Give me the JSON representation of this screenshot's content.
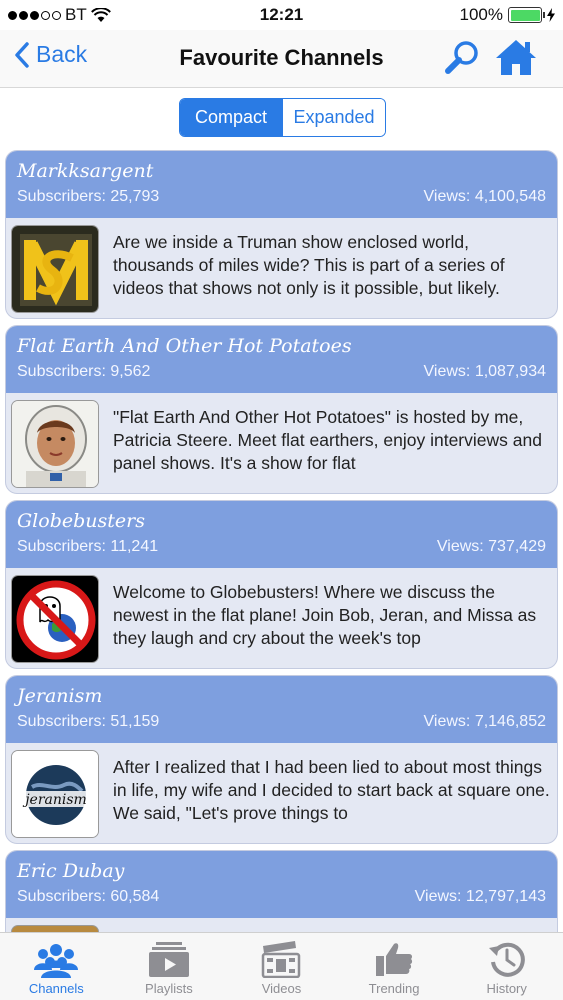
{
  "status": {
    "carrier": "BT",
    "time": "12:21",
    "battery": "100%"
  },
  "nav": {
    "back_label": "Back",
    "title": "Favourite Channels"
  },
  "segments": {
    "compact": "Compact",
    "expanded": "Expanded",
    "selected": "Compact"
  },
  "channels": [
    {
      "name": "Markksargent",
      "subscribers": "Subscribers: 25,793",
      "views": "Views: 4,100,548",
      "description": "Are we inside a Truman show enclosed world, thousands of miles wide? This is part of a series of videos that shows not only is it possible, but likely."
    },
    {
      "name": "Flat Earth And Other Hot Potatoes",
      "subscribers": "Subscribers: 9,562",
      "views": "Views: 1,087,934",
      "description": "\"Flat Earth And Other Hot Potatoes\" is hosted by me, Patricia Steere. Meet flat earthers, enjoy interviews and panel shows. It's a show for flat"
    },
    {
      "name": "Globebusters",
      "subscribers": "Subscribers: 11,241",
      "views": "Views: 737,429",
      "description": "Welcome to Globebusters!  Where we discuss the newest in the flat plane!  Join Bob, Jeran, and Missa as they laugh and cry about the week's top"
    },
    {
      "name": "Jeranism",
      "subscribers": "Subscribers: 51,159",
      "views": "Views: 7,146,852",
      "description": "After I realized that I had been lied to about most things in life, my wife and I decided to start back at square one. We said, \"Let's prove things to",
      "logo_text": "jeranism"
    },
    {
      "name": "Eric Dubay",
      "subscribers": "Subscribers: 60,584",
      "views": "Views: 12,797,143",
      "description": ""
    }
  ],
  "tabs": [
    {
      "label": "Channels",
      "icon": "people-icon",
      "active": true
    },
    {
      "label": "Playlists",
      "icon": "playlist-icon",
      "active": false
    },
    {
      "label": "Videos",
      "icon": "clapperboard-icon",
      "active": false
    },
    {
      "label": "Trending",
      "icon": "thumbs-up-icon",
      "active": false
    },
    {
      "label": "History",
      "icon": "history-icon",
      "active": false
    }
  ],
  "colors": {
    "accent": "#2a7be4",
    "card_header": "#7e9fdf",
    "card_body": "#e4e8f3",
    "battery": "#4cd964"
  }
}
